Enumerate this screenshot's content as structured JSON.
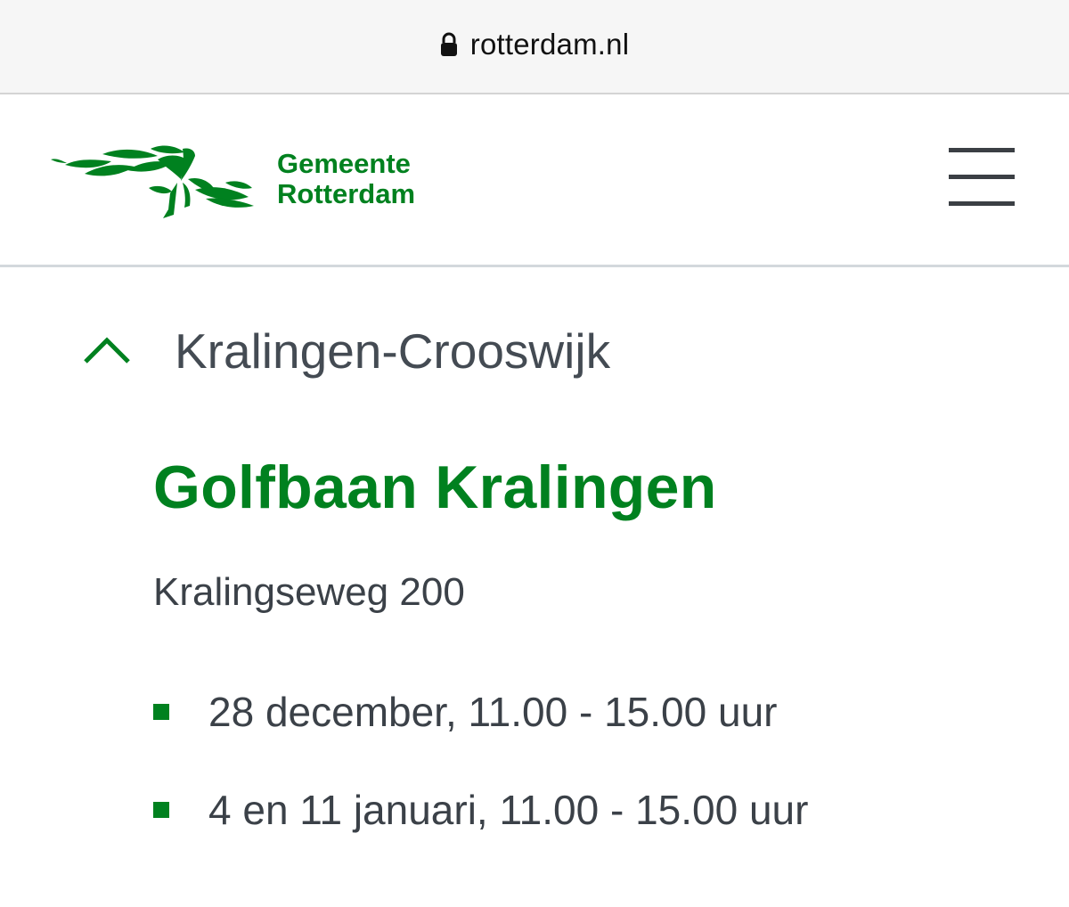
{
  "browser": {
    "url": "rotterdam.nl",
    "lock_icon": "lock-icon"
  },
  "header": {
    "logo_icon": "rotterdam-logo-mark",
    "logo_line1": "Gemeente",
    "logo_line2": "Rotterdam",
    "menu_icon": "hamburger-menu-icon",
    "brand_color": "#00811f"
  },
  "section": {
    "toggle_icon": "chevron-up-icon",
    "title": "Kralingen-Crooswijk"
  },
  "location": {
    "name": "Golfbaan Kralingen",
    "address": "Kralingseweg 200",
    "dates": [
      "28 december, 11.00 - 15.00 uur",
      "4 en 11 januari, 11.00 - 15.00 uur"
    ]
  },
  "colors": {
    "green": "#00811f",
    "text_gray": "#3b4148",
    "divider": "#d3d8dc"
  }
}
